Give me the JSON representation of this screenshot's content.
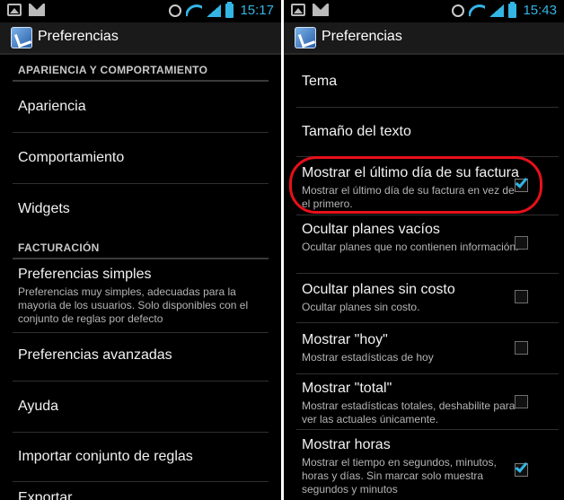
{
  "left": {
    "status": {
      "time": "15:17"
    },
    "title": "Preferencias",
    "categories": [
      "APARIENCIA Y COMPORTAMIENTO",
      "FACTURACIÓN"
    ],
    "items": [
      {
        "title": "Apariencia"
      },
      {
        "title": "Comportamiento"
      },
      {
        "title": "Widgets"
      },
      {
        "title": "Preferencias simples",
        "summary": "Preferencias muy simples, adecuadas para la mayoria de los usuarios. Solo disponibles con el conjunto de reglas por defecto"
      },
      {
        "title": "Preferencias avanzadas"
      },
      {
        "title": "Ayuda"
      },
      {
        "title": "Importar conjunto de reglas"
      },
      {
        "title": "Exportar"
      }
    ]
  },
  "right": {
    "status": {
      "time": "15:43"
    },
    "title": "Preferencias",
    "items": [
      {
        "title": "Tema"
      },
      {
        "title": "Tamaño del texto"
      },
      {
        "title": "Mostrar el último día de su factura",
        "summary": "Mostrar el último día de su factura en vez de el primero.",
        "checked": true
      },
      {
        "title": "Ocultar planes vacíos",
        "summary": "Ocultar planes que no contienen información.",
        "checked": false
      },
      {
        "title": "Ocultar planes sin costo",
        "summary": "Ocultar planes sin costo.",
        "checked": false
      },
      {
        "title": "Mostrar \"hoy\"",
        "summary": "Mostrar estadísticas de hoy",
        "checked": false
      },
      {
        "title": "Mostrar \"total\"",
        "summary": "Mostrar estadísticas totales, deshabilite para ver las actuales únicamente.",
        "checked": false
      },
      {
        "title": "Mostrar horas",
        "summary": "Mostrar el tiempo en segundos, minutos, horas y días. Sin marcar solo muestra segundos y minutos",
        "checked": true
      }
    ]
  },
  "colors": {
    "accent": "#33b5e5",
    "highlight": "#e8101b",
    "background": "#000000"
  },
  "icons": [
    "image-icon",
    "mail-icon",
    "alarm-icon",
    "wifi-icon",
    "signal-icon",
    "battery-icon",
    "app-icon"
  ]
}
